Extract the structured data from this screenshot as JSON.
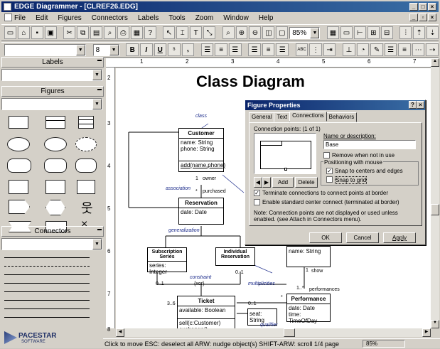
{
  "window": {
    "title": "EDGE Diagrammer - [CLREF26.EDG]"
  },
  "menu": [
    "File",
    "Edit",
    "Figures",
    "Connectors",
    "Labels",
    "Tools",
    "Zoom",
    "Window",
    "Help"
  ],
  "toolbar": {
    "zoom_value": "85%"
  },
  "format_bar": {
    "size_value": "8",
    "bold": "B",
    "italic": "I",
    "underline": "U"
  },
  "panels": {
    "labels": "Labels",
    "figures": "Figures",
    "connectors": "Connectors"
  },
  "ruler_h": [
    "1",
    "2",
    "3",
    "4",
    "5",
    "6",
    "7",
    "8"
  ],
  "ruler_v": [
    "2",
    "3",
    "4",
    "5",
    "6",
    "7",
    "8"
  ],
  "diagram": {
    "title": "Class Diagram",
    "class_label": "class",
    "customer": {
      "name": "Customer",
      "attrs": "name: String\nphone: String",
      "ops": "add(name,phone)"
    },
    "reservation": {
      "name": "Reservation",
      "attrs": "date: Date"
    },
    "subscription": {
      "name": "Subscription Series",
      "attrs": "series: Integer"
    },
    "individual": {
      "name": "Individual Reservation"
    },
    "ticket": {
      "name": "Ticket",
      "attrs": "available: Boolean",
      "ops": "sell(c:Customer)\nexchange()"
    },
    "performance": {
      "name": "Performance",
      "attrs": "date: Date\ntime: TimeOfDay"
    },
    "seat": {
      "text": "seat: String"
    },
    "name_box": {
      "text": "name: String"
    },
    "labels": {
      "association": "association",
      "generalization": "generalization",
      "constraint": "constraint",
      "xor": "{xor}",
      "multiplicities": "multiplicities",
      "qualifier": "qualifier",
      "owner": "owner",
      "purchased": "purchased",
      "one": "1",
      "star": "*",
      "zero_one": "0..1",
      "zero_one_b": "0..1",
      "zero_one_c": "0..1",
      "three_six": "3..6",
      "one_b": "1",
      "one_star": "1..*",
      "star_b": "*",
      "show": "show",
      "performances": "performances",
      "ticket_one": "1"
    }
  },
  "dialog": {
    "title": "Figure Properties",
    "tabs": [
      "General",
      "Text",
      "Connections",
      "Behaviors"
    ],
    "connection_points_label": "Connection points:  (1 of 1)",
    "name_label": "Name or description:",
    "name_value": "Base",
    "remove_label": "Remove when not in use",
    "positioning_label": "Positioning with mouse",
    "snap_centers_label": "Snap to centers and edges",
    "snap_grid_label": "Snap to grid",
    "add_btn": "Add",
    "delete_btn": "Delete",
    "terminate_label": "Terminate connections to connect points at border",
    "enable_label": "Enable standard center connect (terminated at border)",
    "note": "Note: Connection points are not displayed or used unless enabled. (see Attach in Connectors menu).",
    "ok": "OK",
    "cancel": "Cancel",
    "apply": "Apply"
  },
  "status": {
    "text": "Click to move   ESC: deselect all   ARW: nudge object(s)   SHIFT-ARW: scroll 1/4 page",
    "zoom": "85%"
  },
  "logo": {
    "name": "PACESTAR",
    "sub": "SOFTWARE"
  }
}
